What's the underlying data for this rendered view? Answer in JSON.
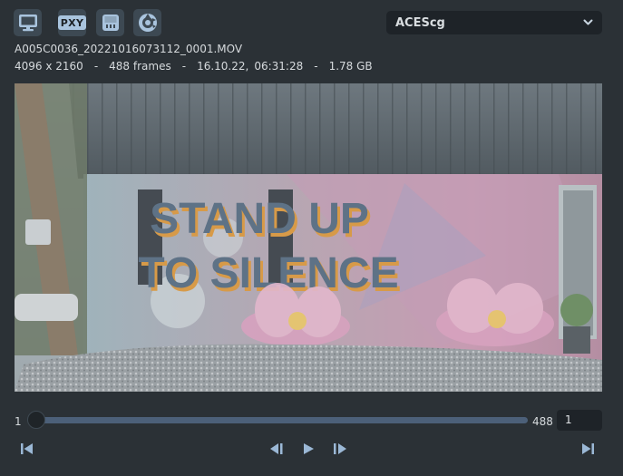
{
  "toolbar": {
    "buttons": [
      {
        "name": "monitor-icon"
      },
      {
        "name": "proxy-button",
        "label": "PXY"
      },
      {
        "name": "save-icon"
      },
      {
        "name": "color-wheel-icon"
      }
    ],
    "colorspace": {
      "value": "ACEScg"
    }
  },
  "clip": {
    "filename": "A005C0036_20221016073112_0001.MOV",
    "resolution": "4096 x 2160",
    "frames": "488 frames",
    "date": "16.10.22,",
    "time": "06:31:28",
    "size": "1.78 GB",
    "separator": "-"
  },
  "viewer": {
    "mural_line1": "STAND UP",
    "mural_line2": "TO SILENCE"
  },
  "timeline": {
    "start": "1",
    "end": "488",
    "current_frame": "1",
    "progress": 0
  },
  "colors": {
    "background": "#2b3136",
    "button": "#3d4953",
    "accent": "#a9c4de",
    "track": "#4c6079"
  },
  "playback": {
    "icons": [
      "go-to-start-icon",
      "step-back-icon",
      "play-icon",
      "step-forward-icon",
      "go-to-end-icon"
    ]
  }
}
